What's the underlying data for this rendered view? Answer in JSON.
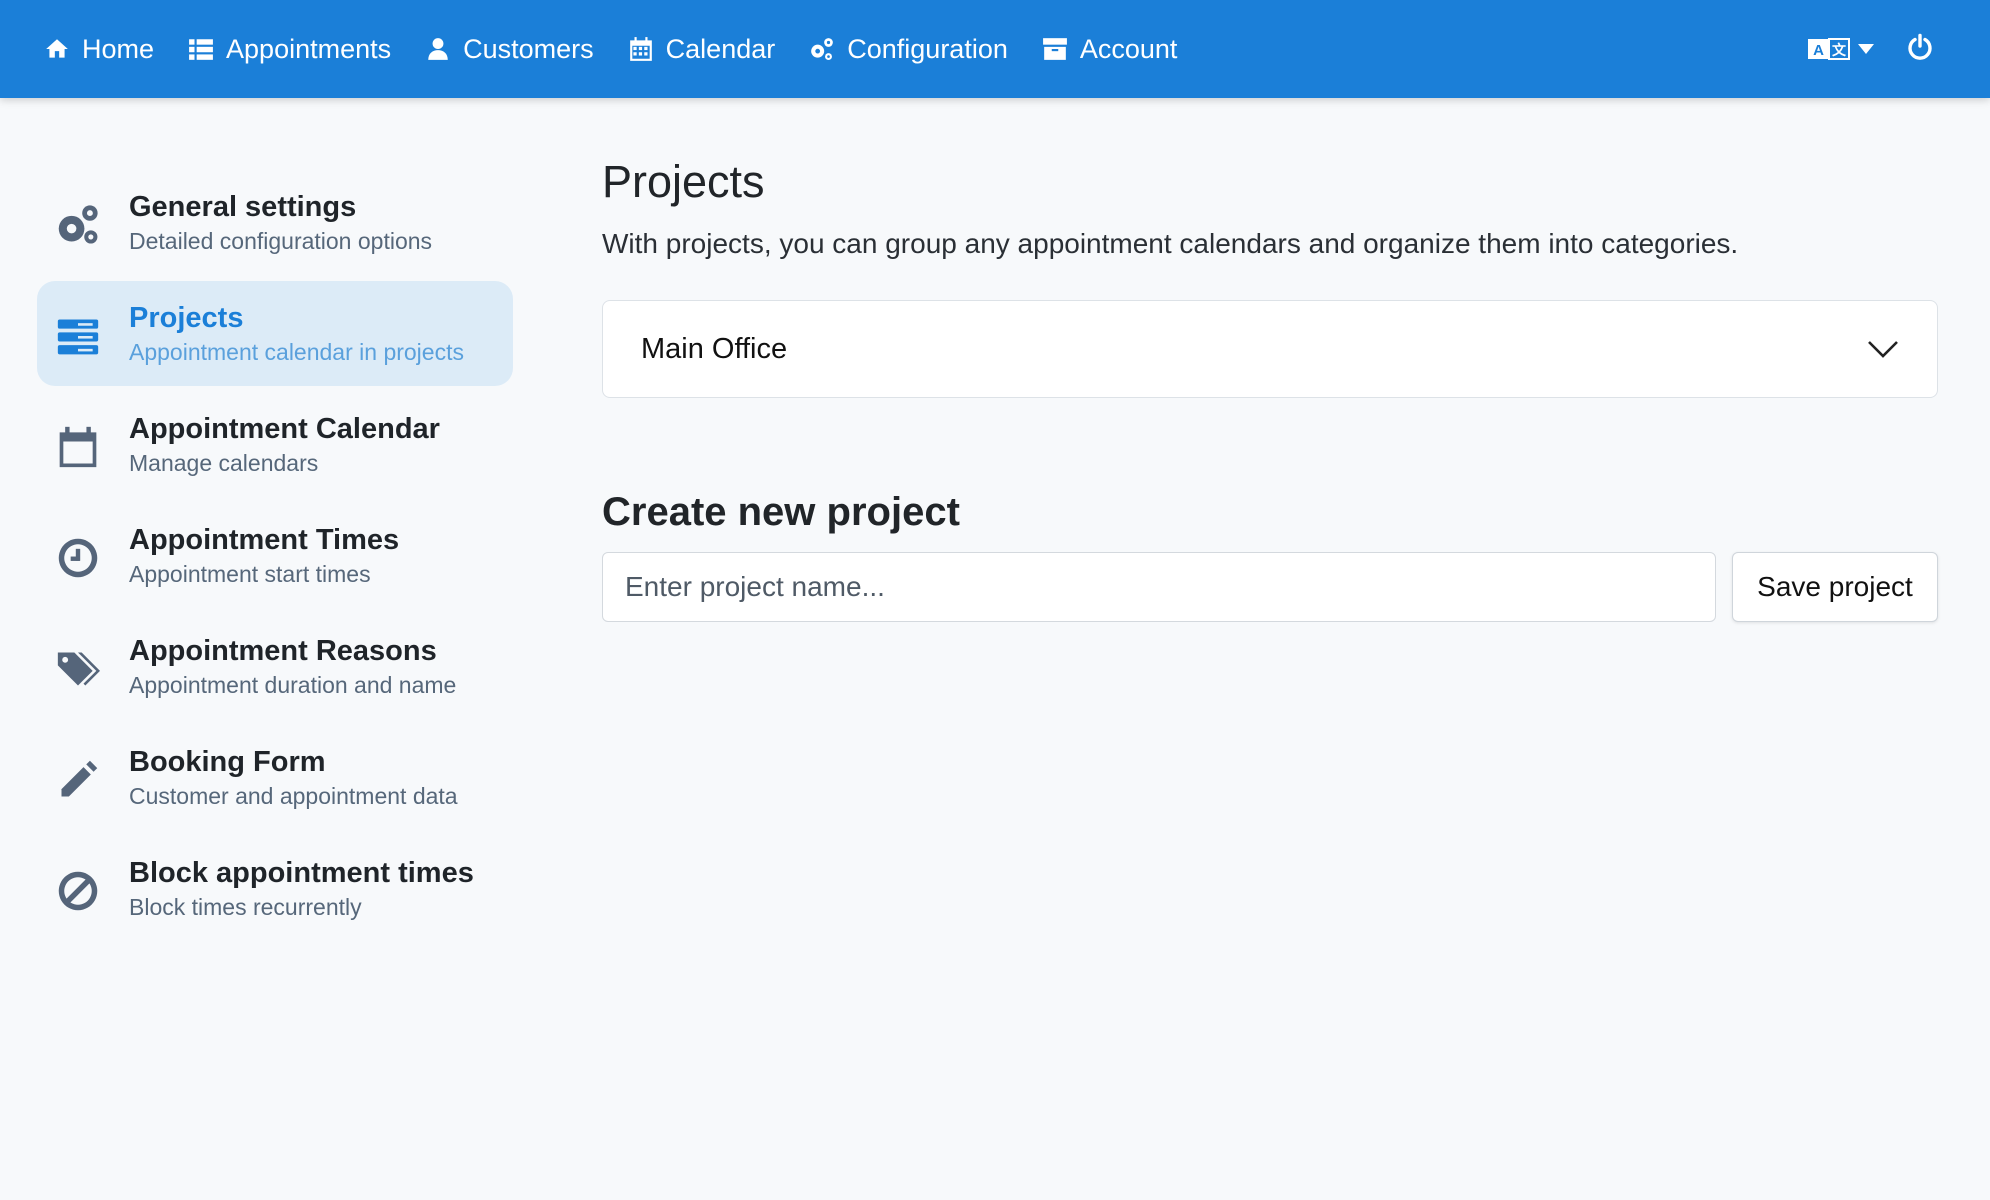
{
  "nav": {
    "items": [
      {
        "label": "Home",
        "icon": "home-icon"
      },
      {
        "label": "Appointments",
        "icon": "list-icon"
      },
      {
        "label": "Customers",
        "icon": "user-icon"
      },
      {
        "label": "Calendar",
        "icon": "calendar-icon"
      },
      {
        "label": "Configuration",
        "icon": "cogs-icon"
      },
      {
        "label": "Account",
        "icon": "archive-icon"
      }
    ],
    "language_icon": "language-icon",
    "power_icon": "power-icon"
  },
  "sidebar": {
    "items": [
      {
        "title": "General settings",
        "subtitle": "Detailed configuration options",
        "icon": "cogs-icon",
        "active": false
      },
      {
        "title": "Projects",
        "subtitle": "Appointment calendar in projects",
        "icon": "server-icon",
        "active": true
      },
      {
        "title": "Appointment Calendar",
        "subtitle": "Manage calendars",
        "icon": "calendar-icon",
        "active": false
      },
      {
        "title": "Appointment Times",
        "subtitle": "Appointment start times",
        "icon": "clock-icon",
        "active": false
      },
      {
        "title": "Appointment Reasons",
        "subtitle": "Appointment duration and name",
        "icon": "tags-icon",
        "active": false
      },
      {
        "title": "Booking Form",
        "subtitle": "Customer and appointment data",
        "icon": "pencil-icon",
        "active": false
      },
      {
        "title": "Block appointment times",
        "subtitle": "Block times recurrently",
        "icon": "ban-icon",
        "active": false
      }
    ]
  },
  "main": {
    "title": "Projects",
    "description": "With projects, you can group any appointment calendars and organize them into categories.",
    "project_select": {
      "label": "Main Office"
    },
    "create_section": {
      "title": "Create new project",
      "input_placeholder": "Enter project name...",
      "input_value": "",
      "save_label": "Save project"
    }
  },
  "colors": {
    "accent": "#1b7fd8",
    "background": "#f7f9fb",
    "active_bg": "#dcebf7"
  }
}
